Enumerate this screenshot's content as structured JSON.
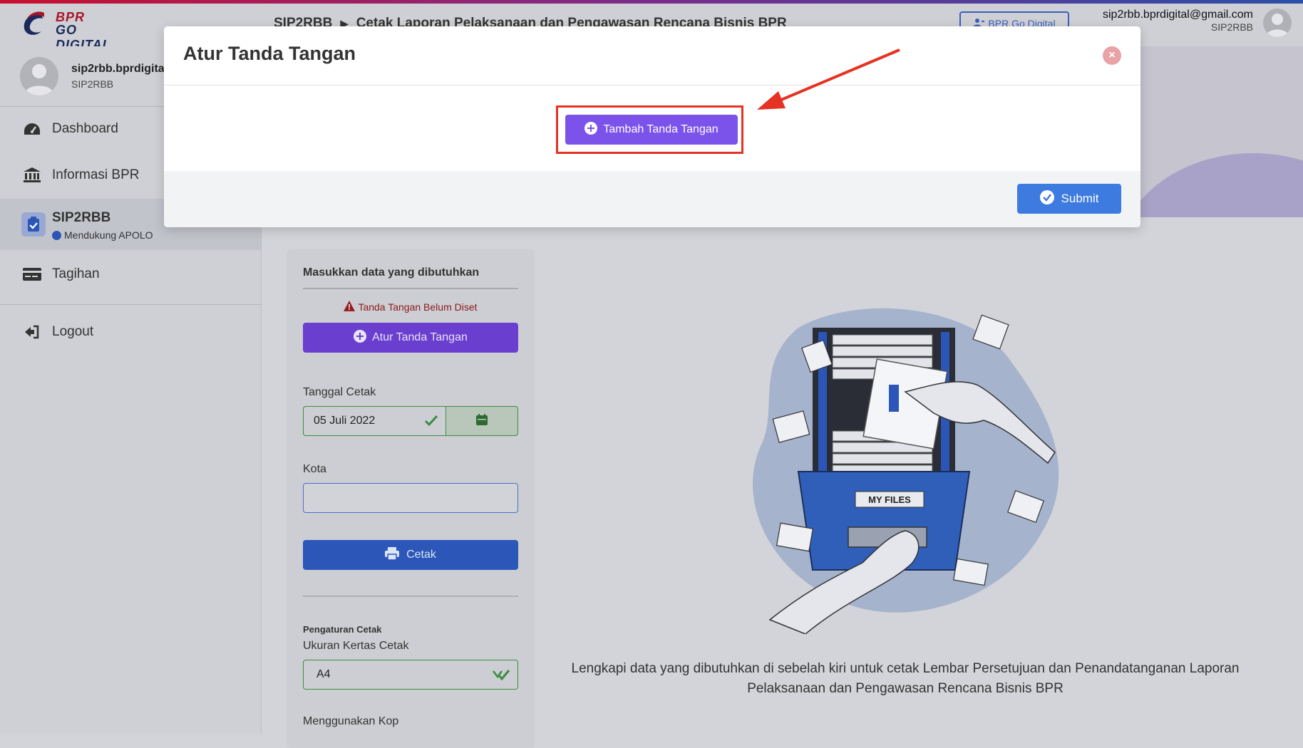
{
  "app": {
    "logo_line1": "BPR",
    "logo_line2": "GO DIGITAL"
  },
  "header": {
    "breadcrumb_root": "SIP2RBB",
    "breadcrumb_page": "Cetak Laporan Pelaksanaan dan Pengawasan Rencana Bisnis BPR",
    "brand_chip": "BPR Go Digital",
    "user_email": "sip2rbb.bprdigital@gmail.com",
    "user_role": "SIP2RBB"
  },
  "sidebar": {
    "user_name": "sip2rbb.bprdigital@gmail.com",
    "user_role": "SIP2RBB",
    "items": [
      {
        "label": "Dashboard",
        "icon": "dashboard-gauge-icon"
      },
      {
        "label": "Informasi BPR",
        "icon": "bank-icon"
      },
      {
        "label": "SIP2RBB",
        "icon": "clipboard-check-icon",
        "sub": "Mendukung APOLO"
      },
      {
        "label": "Tagihan",
        "icon": "credit-card-icon"
      },
      {
        "label": "Logout",
        "icon": "logout-icon"
      }
    ]
  },
  "form": {
    "title": "Masukkan data yang dibutuhkan",
    "warning": "Tanda Tangan Belum Diset",
    "atur_button": "Atur Tanda Tangan",
    "tanggal_label": "Tanggal Cetak",
    "tanggal_value": "05 Juli 2022",
    "kota_label": "Kota",
    "kota_value": "",
    "cetak_button": "Cetak",
    "pengaturan_label": "Pengaturan Cetak",
    "ukuran_label": "Ukuran Kertas Cetak",
    "ukuran_value": "A4",
    "kop_label": "Menggunakan Kop"
  },
  "illustration": {
    "drawer_label": "MY FILES"
  },
  "description": "Lengkapi data yang dibutuhkan di sebelah kiri untuk cetak Lembar Persetujuan dan Penandatanganan Laporan Pelaksanaan dan Pengawasan Rencana Bisnis BPR",
  "modal": {
    "title": "Atur Tanda Tangan",
    "add_button": "Tambah Tanda Tangan",
    "submit_button": "Submit"
  },
  "colors": {
    "primary_purple": "#7b52ea",
    "submit_blue": "#3d7be0",
    "highlight_red": "#e53222",
    "success_green": "#3a8c3f"
  }
}
